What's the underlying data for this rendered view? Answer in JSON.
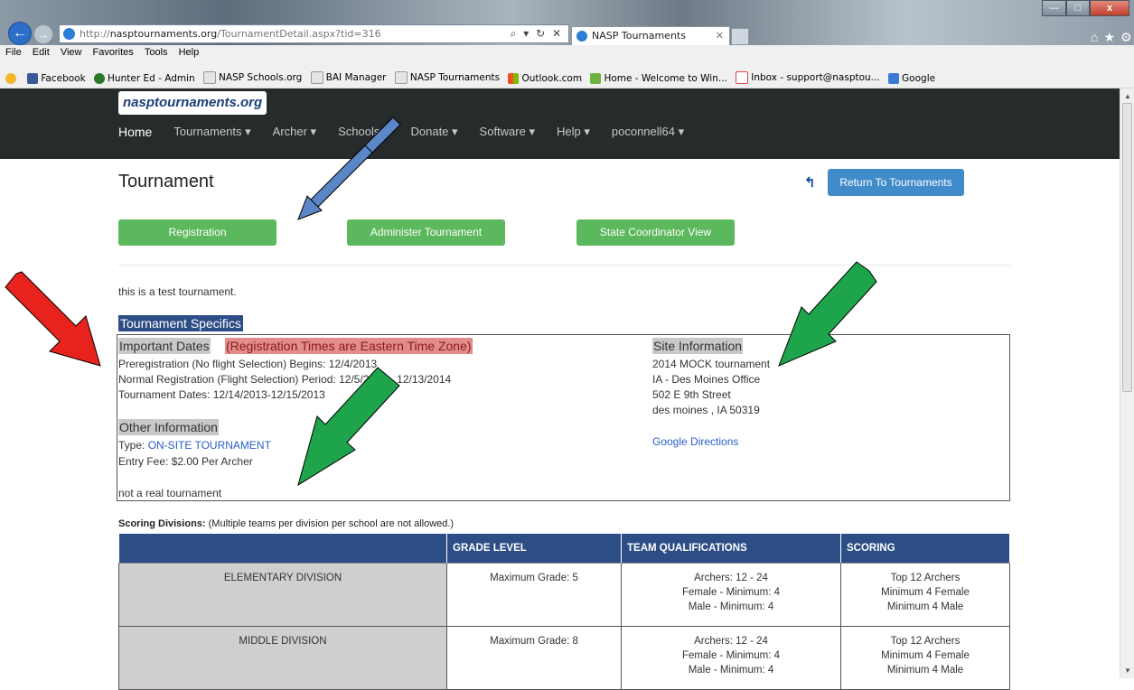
{
  "browser": {
    "url_prefix": "http://",
    "url_host": "nasptournaments.org",
    "url_path": "/TournamentDetail.aspx?tid=316",
    "addr_controls": "⌕ ▾ ↻ ✕",
    "tab_title": "NASP Tournaments",
    "tab_close": "✕",
    "menu": [
      "File",
      "Edit",
      "View",
      "Favorites",
      "Tools",
      "Help"
    ],
    "favorites": [
      "Facebook",
      "Hunter Ed - Admin",
      "NASP Schools.org",
      "BAI Manager",
      "NASP Tournaments",
      "Outlook.com",
      "Home - Welcome to Win...",
      "Inbox - support@nasptou...",
      "Google"
    ],
    "win_min": "—",
    "win_max": "□",
    "win_close": "x",
    "tool_icons": "⌂★⚙"
  },
  "site": {
    "brand": "nasptournaments.org",
    "nav": {
      "home": "Home",
      "tournaments": "Tournaments ▾",
      "archer": "Archer ▾",
      "schools": "Schools ▾",
      "donate": "Donate ▾",
      "software": "Software ▾",
      "help": "Help ▾",
      "user": "poconnell64 ▾"
    }
  },
  "page": {
    "title": "Tournament",
    "return_button": "Return To Tournaments",
    "registration_button": "Registration",
    "administer_button": "Administer Tournament",
    "state_coordinator_button": "State Coordinator View",
    "description": "this is a test tournament.",
    "specifics_heading": "Tournament Specifics",
    "important_dates_heading": "Important Dates",
    "timezone_note": "(Registration Times are Eastern Time Zone)",
    "preregistration": "Preregistration (No flight Selection) Begins: 12/4/2013",
    "normal_registration": "Normal Registration (Flight Selection) Period: 12/5/2013 - 12/13/2014",
    "tournament_dates": "Tournament Dates: 12/14/2013-12/15/2013",
    "other_info_heading": "Other Information",
    "type_label": "Type: ",
    "type_value": "ON-SITE TOURNAMENT",
    "entry_fee": "Entry Fee: $2.00 Per Archer",
    "notes": "not a real tournament",
    "site_info_heading": "Site Information",
    "site_lines": [
      "2014 MOCK tournament",
      "IA - Des Moines Office",
      "502 E 9th Street",
      "des moines , IA 50319"
    ],
    "directions_link": "Google Directions",
    "scoring_label": "Scoring Divisions:",
    "scoring_note": " (Multiple teams per division per school are not allowed.)"
  },
  "divisions_table": {
    "headers": [
      "",
      "GRADE LEVEL",
      "TEAM QUALIFICATIONS",
      "SCORING"
    ],
    "rows": [
      {
        "division": "ELEMENTARY DIVISION",
        "grade": "Maximum Grade: 5",
        "qual": [
          "Archers: 12 - 24",
          "Female - Minimum: 4",
          "Male - Minimum: 4"
        ],
        "scoring": [
          "Top 12 Archers",
          "Minimum 4 Female",
          "Minimum 4 Male"
        ]
      },
      {
        "division": "MIDDLE DIVISION",
        "grade": "Maximum Grade: 8",
        "qual": [
          "Archers: 12 - 24",
          "Female - Minimum: 4",
          "Male - Minimum: 4"
        ],
        "scoring": [
          "Top 12 Archers",
          "Minimum 4 Female",
          "Minimum 4 Male"
        ]
      }
    ]
  },
  "colors": {
    "navbar": "#262b2b",
    "primary_button": "#428bca",
    "success_button": "#5cb85c",
    "table_header": "#2c4d86",
    "arrow_blue": "#5b86c7",
    "arrow_green": "#1ea44a",
    "arrow_red": "#e8231d"
  }
}
